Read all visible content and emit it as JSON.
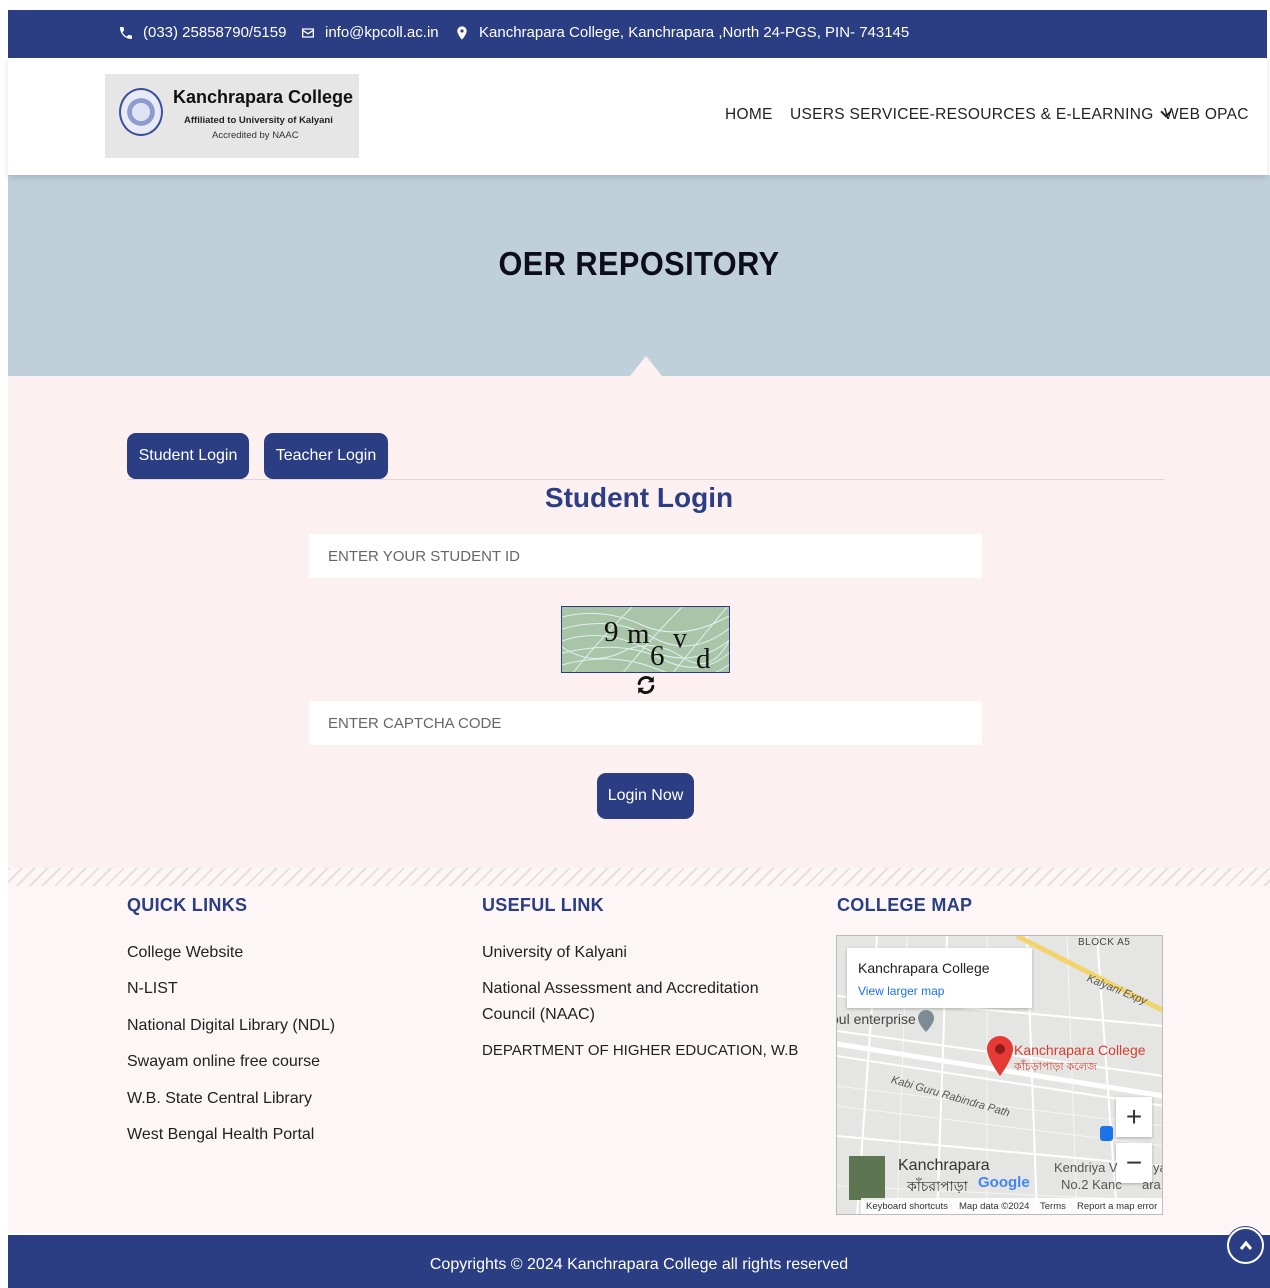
{
  "topbar": {
    "phone": "(033) 25858790/5159",
    "email": "info@kpcoll.ac.in",
    "address": "Kanchrapara College, Kanchrapara ,North 24-PGS, PIN- 743145"
  },
  "logo": {
    "title": "Kanchrapara College",
    "affiliation": "Affiliated to University of Kalyani",
    "accreditation": "Accredited by NAAC"
  },
  "nav": {
    "home": "HOME",
    "users_service": "USERS SERVICE",
    "eresources": "E-RESOURCES & E-LEARNING",
    "web_opac": "WEB OPAC"
  },
  "hero": {
    "title": "OER REPOSITORY"
  },
  "login": {
    "tab_student": "Student Login",
    "tab_teacher": "Teacher Login",
    "form_title": "Student Login",
    "student_id_placeholder": "ENTER YOUR STUDENT ID",
    "captcha_placeholder": "ENTER CAPTCHA CODE",
    "captcha_chars": [
      "9",
      "m",
      "6",
      "v",
      "d"
    ],
    "submit_label": "Login Now"
  },
  "footer": {
    "quick_links_title": "QUICK LINKS",
    "quick_links": [
      "College Website",
      "N-LIST",
      "National Digital Library (NDL)",
      "Swayam online free course",
      "W.B. State Central Library",
      "West Bengal Health Portal"
    ],
    "useful_link_title": "USEFUL LINK",
    "useful_links": [
      "University of Kalyani",
      "National Assessment and Accreditation",
      "Council (NAAC)",
      "DEPARTMENT OF HIGHER EDUCATION, W.B"
    ],
    "map_title": "COLLEGE MAP",
    "map": {
      "place_name": "Kanchrapara College",
      "view_larger": "View larger map",
      "pin_label": "Kanchrapara College",
      "pin_label_bn": "কাঁচড়াপাড়া কলেজ",
      "block": "BLOCK A5",
      "road": "Kalyani Expy",
      "street": "Kabi Guru Rabindra Path",
      "enterprise": "oul enterprise",
      "town": "Kanchrapara",
      "town_bn": "কাঁচরাপাড়া",
      "school_1": "Kendriya V",
      "school_1b": "ya",
      "school_2": "No.2 Kanc",
      "school_2b": "ara",
      "zoom_in": "+",
      "zoom_out": "−",
      "google": "Google",
      "keyboard": "Keyboard shortcuts",
      "map_data": "Map data ©2024",
      "terms": "Terms",
      "report": "Report a map error"
    }
  },
  "copyright": "Copyrights © 2024 Kanchrapara College all rights reserved",
  "colors": {
    "primary": "#2c3e83",
    "hero_bg": "#bfd0db",
    "main_bg": "#fcf0f0"
  }
}
